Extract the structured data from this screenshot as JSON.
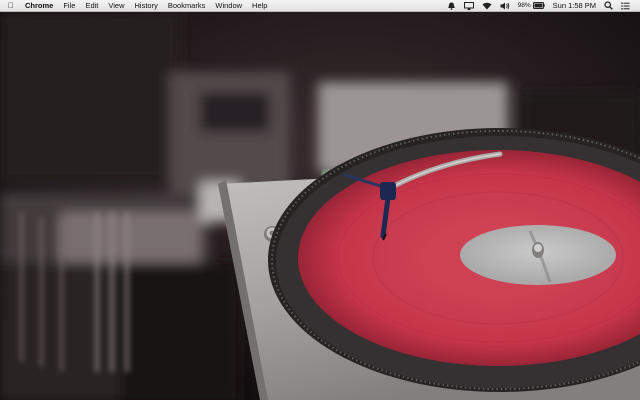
{
  "menubar": {
    "app_name": "Chrome",
    "items": [
      "File",
      "Edit",
      "View",
      "History",
      "Bookmarks",
      "Window",
      "Help"
    ],
    "status": {
      "battery_percent": "98%",
      "clock": "Sun 1:58 PM"
    },
    "icons": [
      "apple-icon",
      "notification-icon",
      "airplay-icon",
      "wifi-icon",
      "volume-icon",
      "battery-icon",
      "spotlight-icon",
      "notification-center-icon"
    ]
  },
  "desktop": {
    "wallpaper": "turntable with red vinyl record",
    "colors": {
      "vinyl": "#d8384f",
      "label": "#c9c9c9",
      "deck": "#bdbab8",
      "background": "#1a1418"
    }
  }
}
